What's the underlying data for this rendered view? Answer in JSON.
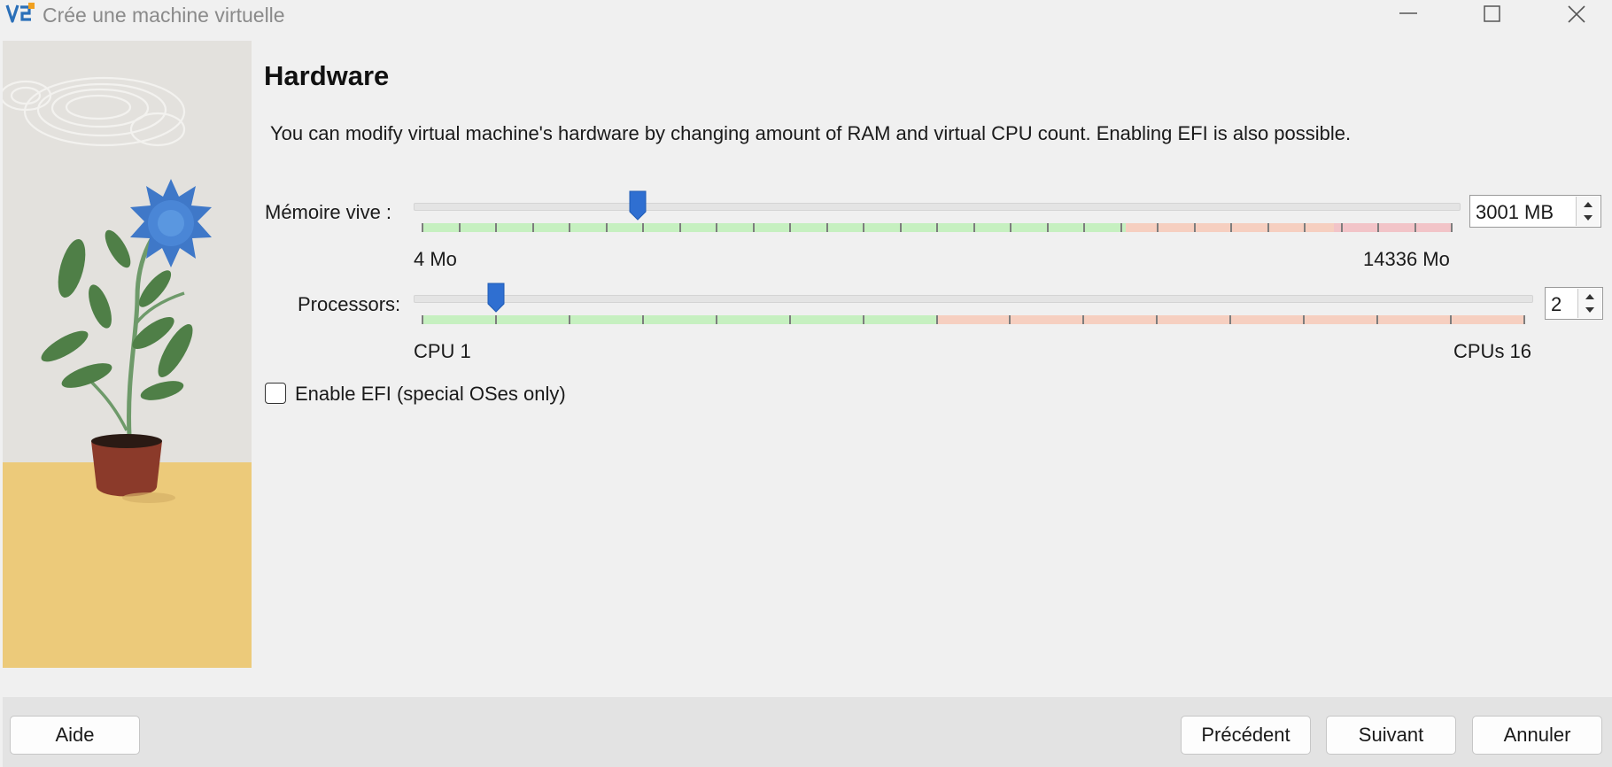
{
  "window": {
    "title": "Crée une machine virtuelle"
  },
  "page": {
    "title": "Hardware",
    "description": "You can modify virtual machine's hardware by changing amount of RAM and virtual CPU count. Enabling EFI is also possible."
  },
  "memory": {
    "label": "Mémoire vive :",
    "min_label": "4 Mo",
    "max_label": "14336 Mo",
    "min": 4,
    "max": 14336,
    "value": 3001,
    "spin_value": "3001 MB",
    "recommended_max": 9800,
    "caution_max": 12700
  },
  "processors": {
    "label": "Processors:",
    "min_label": "CPU 1",
    "max_label": "CPUs 16",
    "min": 1,
    "max": 16,
    "value": 2,
    "spin_value": "2",
    "recommended_max": 8
  },
  "efi": {
    "label": "Enable EFI (special OSes only)",
    "checked": false
  },
  "buttons": {
    "help": "Aide",
    "back": "Précédent",
    "next": "Suivant",
    "cancel": "Annuler"
  },
  "colors": {
    "ok": "#c6f0c0",
    "caution": "#f6cfc0",
    "danger": "#f2c4c8",
    "handle": "#2f6fd1"
  }
}
